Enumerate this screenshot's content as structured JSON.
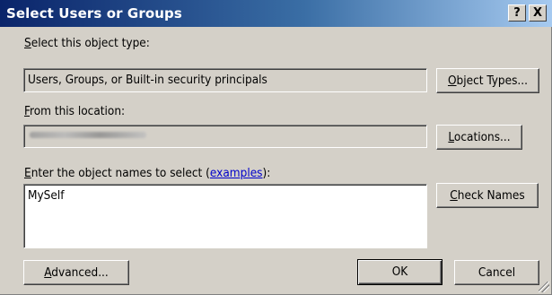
{
  "window": {
    "title": "Select Users or Groups",
    "help_label": "?",
    "close_label": "X"
  },
  "object_type": {
    "label_key": "S",
    "label_rest": "elect this object type:",
    "value": "Users, Groups, or Built-in security principals",
    "button_key": "O",
    "button_rest": "bject Types..."
  },
  "location": {
    "label_key": "F",
    "label_rest": "rom this location:",
    "value": "",
    "value_blurred": true,
    "button_key": "L",
    "button_rest": "ocations..."
  },
  "names": {
    "label_key": "E",
    "label_pre": "nter the object names to select (",
    "link": "examples",
    "label_post": "):",
    "value": "MySelf",
    "check_key": "C",
    "check_rest": "heck Names"
  },
  "footer": {
    "advanced_key": "A",
    "advanced_rest": "dvanced...",
    "ok": "OK",
    "cancel": "Cancel"
  },
  "colors": {
    "title_gradient_start": "#0a246a",
    "title_gradient_end": "#a6caf0",
    "face": "#d4d0c8",
    "link": "#0000cc"
  }
}
